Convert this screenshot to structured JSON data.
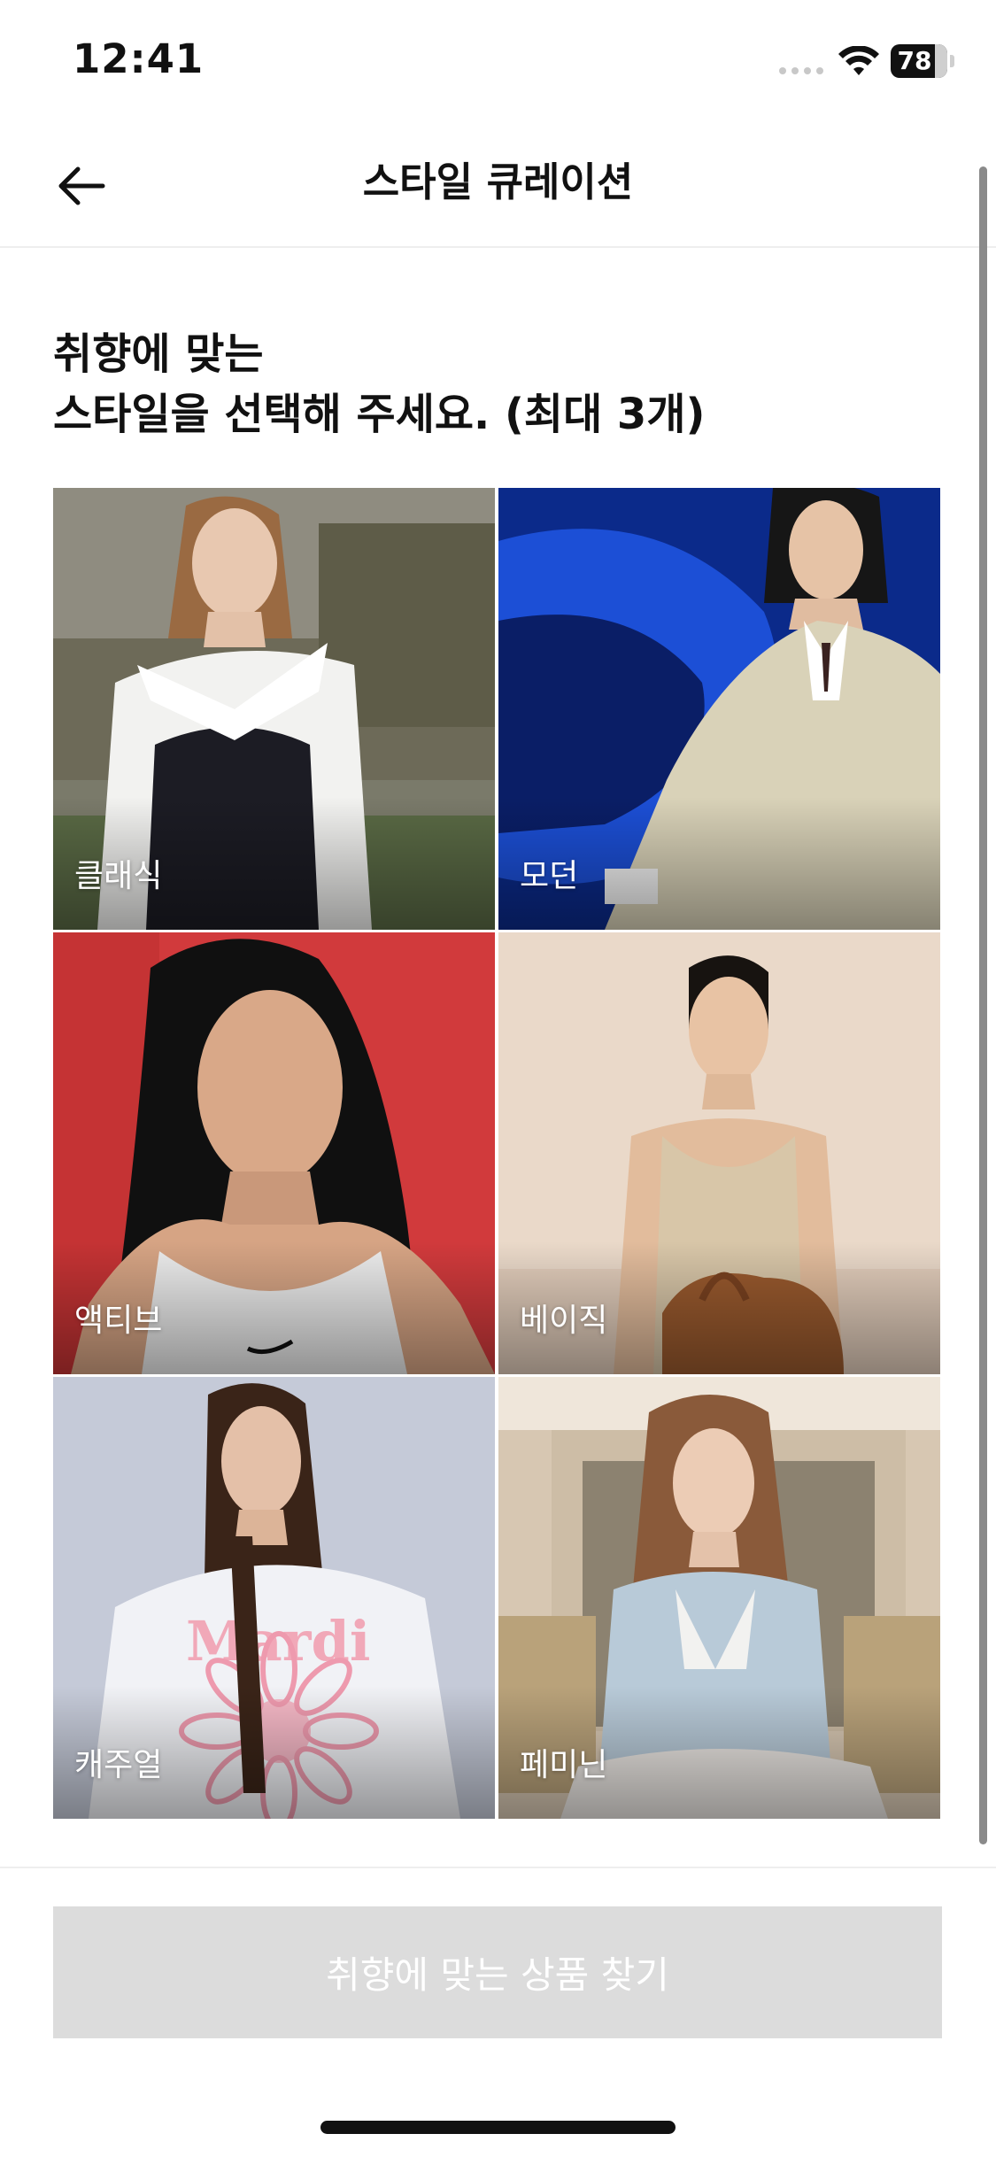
{
  "status_bar": {
    "time": "12:41",
    "battery": "78",
    "battery_level_percent": 78,
    "icons": [
      "signal-dots-icon",
      "wifi-icon",
      "battery-icon"
    ]
  },
  "nav": {
    "back_icon": "arrow-left-icon",
    "title": "스타일 큐레이션"
  },
  "heading": {
    "line1": "취향에 맞는",
    "line2": "스타일을 선택해 주세요. (최대 3개)"
  },
  "styles": [
    {
      "label": "클래식"
    },
    {
      "label": "모던"
    },
    {
      "label": "액티브"
    },
    {
      "label": "베이직"
    },
    {
      "label": "캐주얼"
    },
    {
      "label": "페미닌"
    }
  ],
  "footer": {
    "cta_label": "취향에 맞는 상품 찾기",
    "cta_color": "#dcdcdc"
  }
}
